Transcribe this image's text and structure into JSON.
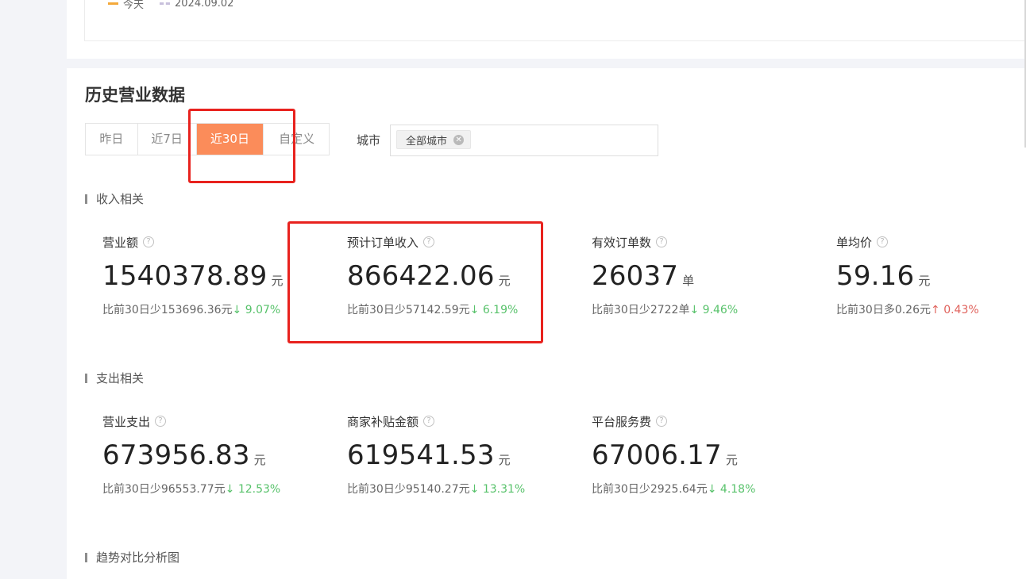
{
  "legend": {
    "today": "今天",
    "compare_date": "2024.09.02"
  },
  "title": "历史营业数据",
  "tabs": [
    {
      "label": "昨日"
    },
    {
      "label": "近7日"
    },
    {
      "label": "近30日"
    },
    {
      "label": "自定义"
    }
  ],
  "city": {
    "label": "城市",
    "chip": "全部城市"
  },
  "sections": {
    "income": "收入相关",
    "expense": "支出相关",
    "trend": "趋势对比分析图"
  },
  "income_metrics": [
    {
      "title": "营业额",
      "value": "1540378.89",
      "unit": "元",
      "compare": "比前30日少153696.36元",
      "arrow": "↓",
      "pct": "9.07%"
    },
    {
      "title": "预计订单收入",
      "value": "866422.06",
      "unit": "元",
      "compare": "比前30日少57142.59元",
      "arrow": "↓",
      "pct": "6.19%"
    },
    {
      "title": "有效订单数",
      "value": "26037",
      "unit": "单",
      "compare": "比前30日少2722单",
      "arrow": "↓",
      "pct": "9.46%"
    },
    {
      "title": "单均价",
      "value": "59.16",
      "unit": "元",
      "compare": "比前30日多0.26元",
      "arrow": "↑",
      "pct": "0.43%"
    }
  ],
  "expense_metrics": [
    {
      "title": "营业支出",
      "value": "673956.83",
      "unit": "元",
      "compare": "比前30日少96553.77元",
      "arrow": "↓",
      "pct": "12.53%"
    },
    {
      "title": "商家补贴金额",
      "value": "619541.53",
      "unit": "元",
      "compare": "比前30日少95140.27元",
      "arrow": "↓",
      "pct": "13.31%"
    },
    {
      "title": "平台服务费",
      "value": "67006.17",
      "unit": "元",
      "compare": "比前30日少2925.64元",
      "arrow": "↓",
      "pct": "4.18%"
    }
  ],
  "colors": {
    "active_tab": "#fb8c5a",
    "decrease": "#58c26b",
    "increase": "#e0625c",
    "annotation": "#e8221e"
  },
  "icons": {
    "help": "question-circle-icon",
    "chip_close": "close-circle-icon"
  }
}
